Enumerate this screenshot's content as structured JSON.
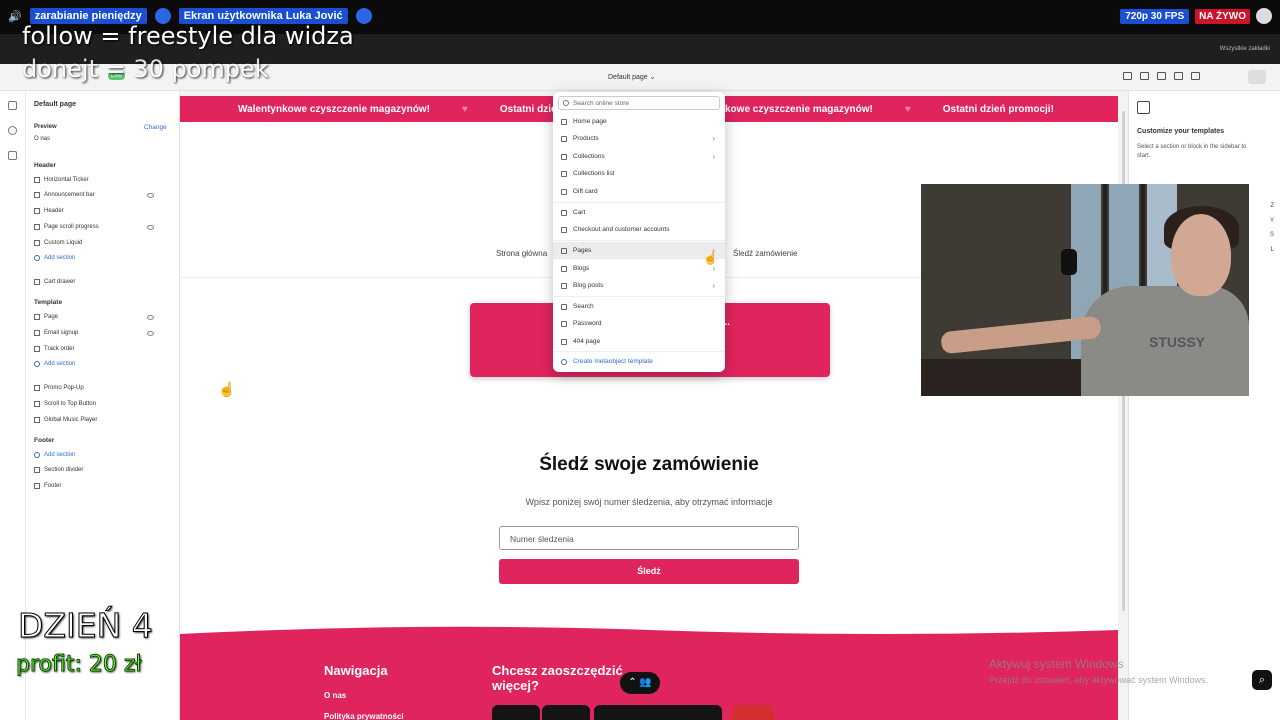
{
  "meet": {
    "stream_title": "zarabianie pieniędzy",
    "screen_title": "Ekran użytkownika Luka Jović",
    "quality": "720p 30 FPS",
    "live": "NA ŻYWO"
  },
  "browser": {
    "bookmarks": "Wszystkie zakładki"
  },
  "editor": {
    "live_badge": "Live",
    "template_picker": "Default page",
    "save_label": ""
  },
  "sidebar": {
    "page_title": "Default page",
    "preview_label": "Preview",
    "change_label": "Change",
    "preview_value": "O nas",
    "header_section": "Header",
    "header_items": [
      "Horizontal Ticker",
      "Announcement bar",
      "Header",
      "Page scroll progress",
      "Custom Liquid"
    ],
    "add_section": "Add section",
    "cart_drawer": "Cart drawer",
    "template_section": "Template",
    "template_items": [
      "Page",
      "Email signup",
      "Track order"
    ],
    "app_items": [
      "Promo Pop-Up",
      "Scroll to Top Button",
      "Global Music Player"
    ],
    "footer_section": "Footer",
    "footer_items": [
      "Section divider",
      "Footer"
    ]
  },
  "store": {
    "ticker_items": [
      "Walentynkowe czyszczenie magazynów!",
      "Ostatni dzień promocji!",
      "Walentynkowe czyszczenie magazynów!",
      "Ostatni dzień promocji!"
    ],
    "nav_home": "Strona główna",
    "nav_track": "Śledź zamówienie",
    "promo_text": "ię za...",
    "track_title": "Śledź swoje zamówienie",
    "track_sub": "Wpisz poniżej swój numer śledzenia, aby otrzymać informacje",
    "track_placeholder": "Numer śledzenia",
    "track_button": "Śledź",
    "footer_nav_title": "Nawigacja",
    "footer_nav_links": [
      "O nas",
      "Polityka prywatności"
    ],
    "footer_save_title": "Chcesz zaoszczędzić więcej?"
  },
  "dropdown": {
    "search_placeholder": "Search online store",
    "items": [
      {
        "label": "Home page",
        "chevron": false
      },
      {
        "label": "Products",
        "chevron": true
      },
      {
        "label": "Collections",
        "chevron": true
      },
      {
        "label": "Collections list",
        "chevron": false
      },
      {
        "label": "Gift card",
        "chevron": false
      },
      {
        "label": "Cart",
        "chevron": false
      },
      {
        "label": "Checkout and customer accounts",
        "chevron": false
      },
      {
        "label": "Pages",
        "chevron": true
      },
      {
        "label": "Blogs",
        "chevron": true
      },
      {
        "label": "Blog posts",
        "chevron": true
      },
      {
        "label": "Search",
        "chevron": false
      },
      {
        "label": "Password",
        "chevron": false
      },
      {
        "label": "404 page",
        "chevron": false
      }
    ],
    "create_label": "Create metaobject template"
  },
  "right_panel": {
    "title": "Customize your templates",
    "description": "Select a section or block in the sidebar to start.",
    "keys": [
      "Z",
      "Y",
      "S",
      "L"
    ]
  },
  "overlays": {
    "follow": "follow = freestyle dla widza",
    "donejt": "donejt = 30 pompek",
    "day": "DZIEŃ 4",
    "profit": "profit: 20 zł"
  },
  "windows": {
    "activate_title": "Aktywuj system Windows",
    "activate_sub": "Przejdź do ustawień, aby aktywować system Windows."
  },
  "webcam": {
    "shirt_text": "STUSSY"
  },
  "colors": {
    "brand_pink": "#e0245e",
    "link_blue": "#2c6ecb",
    "live_red": "#c9142b"
  }
}
